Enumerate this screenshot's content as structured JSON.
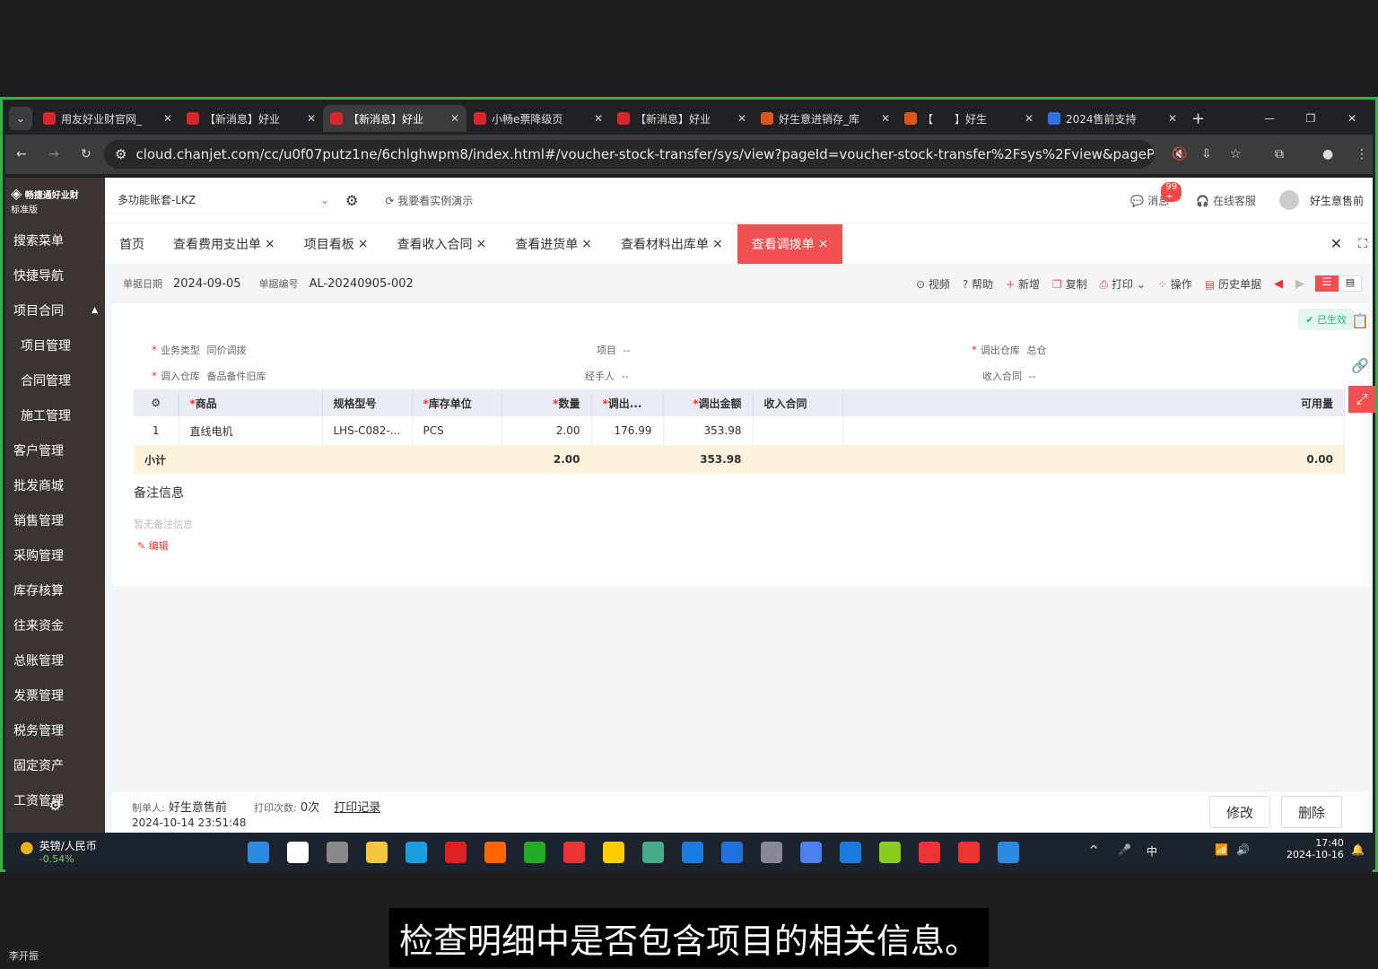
{
  "browser": {
    "tabs": [
      {
        "title": "用友好业财官网_",
        "color": "#d9232d"
      },
      {
        "title": "【新消息】好业",
        "color": "#d9232d"
      },
      {
        "title": "【新消息】好业",
        "color": "#d9232d"
      },
      {
        "title": "小畅e票降级页",
        "color": "#d9232d"
      },
      {
        "title": "【新消息】好业",
        "color": "#d9232d"
      },
      {
        "title": "好生意进销存_库",
        "color": "#e0541e"
      },
      {
        "title": "【　　】好生",
        "color": "#e0541e"
      },
      {
        "title": "2024售前支持",
        "color": "#2f6fe0"
      }
    ],
    "active_tab": 2,
    "url": "cloud.chanjet.com/cc/u0f07putz1ne/6chlghwpm8/index.html#/voucher-stock-transfer/sys/view?pageId=voucher-stock-transfer%2Fsys%2Fview&pageParams=%7B\"ro..."
  },
  "sidebar": {
    "brand": "畅捷通好业财",
    "edition": "标准版",
    "items": [
      "搜索菜单",
      "快捷导航",
      "项目合同",
      "项目管理",
      "合同管理",
      "施工管理",
      "客户管理",
      "批发商城",
      "销售管理",
      "采购管理",
      "库存核算",
      "往来资金",
      "总账管理",
      "发票管理",
      "税务管理",
      "固定资产",
      "工资管理"
    ]
  },
  "topbar": {
    "account": "多功能账套-LKZ",
    "demo": "我要看实例演示",
    "messages": "消息",
    "badge": "99 +",
    "service": "在线客服",
    "user": "好生意售前"
  },
  "pagetabs": [
    {
      "label": "首页",
      "closable": false
    },
    {
      "label": "查看费用支出单",
      "closable": true
    },
    {
      "label": "项目看板",
      "closable": true
    },
    {
      "label": "查看收入合同",
      "closable": true
    },
    {
      "label": "查看进货单",
      "closable": true
    },
    {
      "label": "查看材料出库单",
      "closable": true
    },
    {
      "label": "查看调拨单",
      "closable": true,
      "active": true
    }
  ],
  "info": {
    "date_label": "单据日期",
    "date": "2024-09-05",
    "no_label": "单据编号",
    "no": "AL-20240905-002"
  },
  "actions": [
    "视频",
    "帮助",
    "新增",
    "复制",
    "打印",
    "操作",
    "历史单据"
  ],
  "status": "已生效",
  "form": {
    "biz_type_label": "业务类型",
    "biz_type": "同价调拨",
    "project_label": "项目",
    "project": "--",
    "out_wh_label": "调出仓库",
    "out_wh": "总仓",
    "in_wh_label": "调入仓库",
    "in_wh": "备品备件旧库",
    "handler_label": "经手人",
    "handler": "--",
    "contract_label": "收入合同",
    "contract": "--"
  },
  "table": {
    "headers": [
      "商品",
      "规格型号",
      "库存单位",
      "数量",
      "调出...",
      "调出金额",
      "收入合同",
      "可用量"
    ],
    "rows": [
      [
        "1",
        "直线电机",
        "LHS-C082-...",
        "PCS",
        "2.00",
        "176.99",
        "353.98",
        "",
        ""
      ]
    ],
    "subtotal": {
      "label": "小计",
      "qty": "2.00",
      "amount": "353.98",
      "avail": "0.00"
    }
  },
  "remark": {
    "title": "备注信息",
    "empty": "暂无备注信息",
    "edit": "编辑"
  },
  "footer": {
    "creator_label": "制单人:",
    "creator": "好生意售前",
    "print_label": "打印次数:",
    "print_count": "0次",
    "print_log": "打印记录",
    "created_at": "2024-10-14 23:51:48",
    "modify": "修改",
    "delete": "删除"
  },
  "taskbar": {
    "widget_title": "英镑/人民币",
    "widget_value": "-0.54%",
    "ime": "中",
    "time": "17:40",
    "date": "2024-10-16"
  },
  "subtitle": "检查明细中是否包含项目的相关信息。",
  "watermark": "李开振"
}
